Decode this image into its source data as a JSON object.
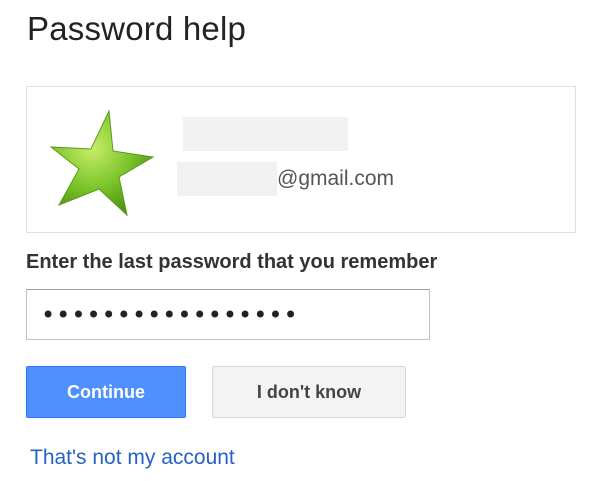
{
  "page": {
    "title": "Password help"
  },
  "account": {
    "avatar_icon": "star-icon",
    "email_domain": "@gmail.com"
  },
  "password_form": {
    "label": "Enter the last password that you remember",
    "value": "•••••••••••••••••"
  },
  "buttons": {
    "continue_label": "Continue",
    "dont_know_label": "I don't know"
  },
  "links": {
    "not_my_account": "That's not my account"
  },
  "colors": {
    "primary_button": "#4d90fe",
    "link": "#2662c3",
    "star_green": "#7dc42b"
  }
}
